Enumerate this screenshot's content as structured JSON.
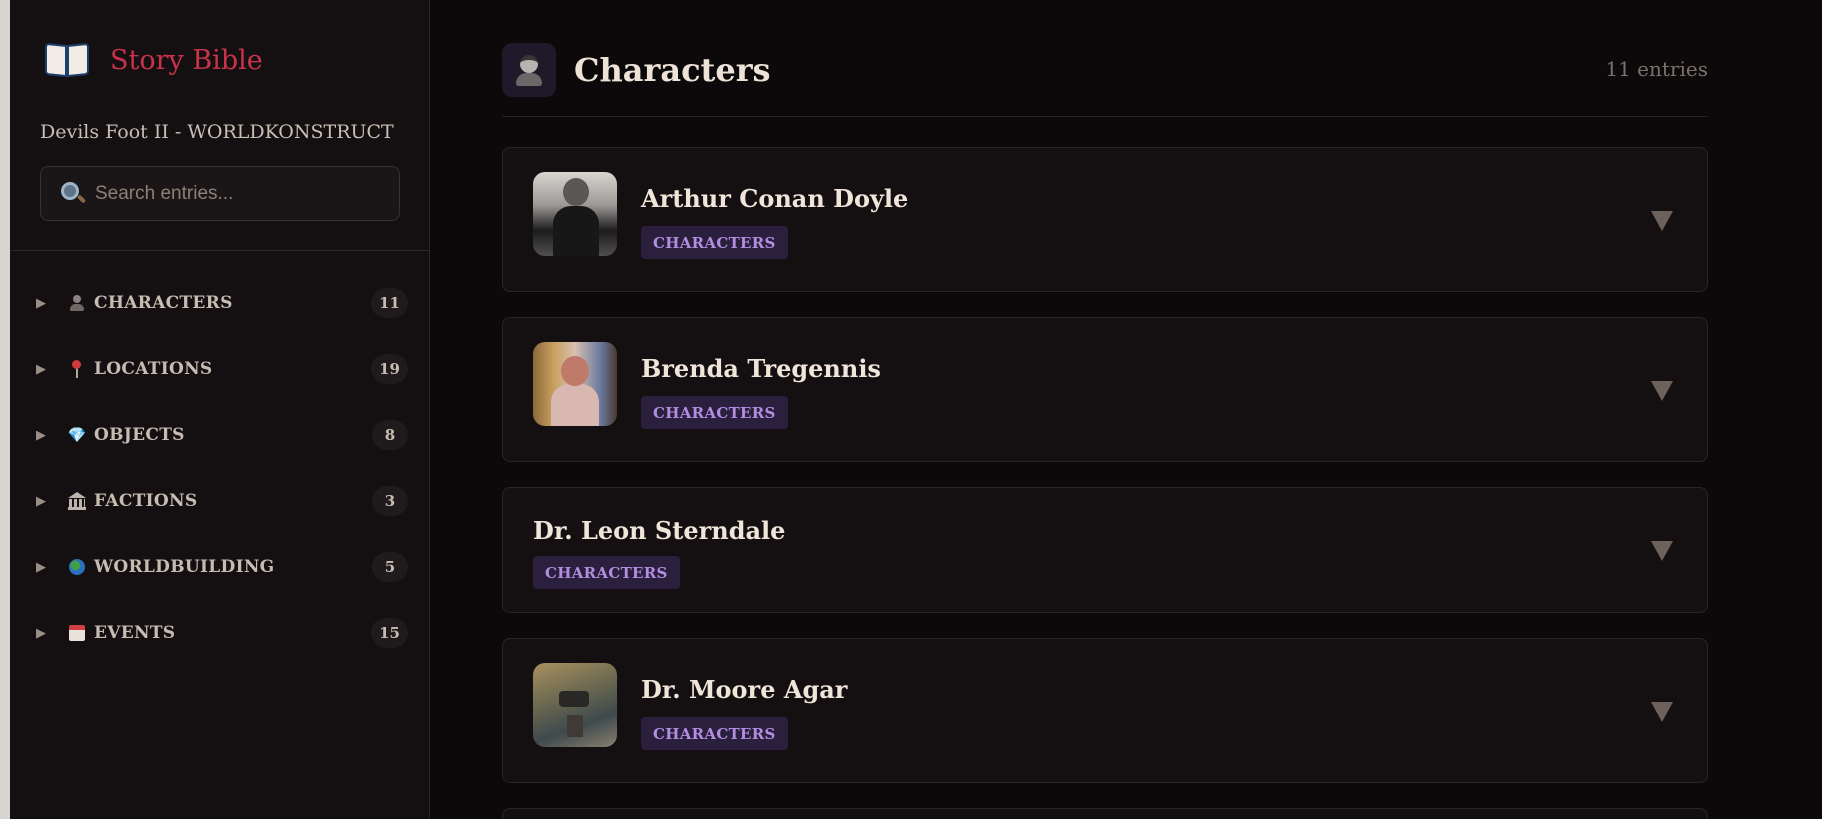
{
  "sidebar": {
    "brand_title": "Story Bible",
    "project_name": "Devils Foot II - WORLDKONSTRUCT",
    "search": {
      "placeholder": "Search entries...",
      "value": ""
    },
    "items": [
      {
        "label": "CHARACTERS",
        "count": "11",
        "icon": "person-icon"
      },
      {
        "label": "LOCATIONS",
        "count": "19",
        "icon": "pin-icon"
      },
      {
        "label": "OBJECTS",
        "count": "8",
        "icon": "gem-icon"
      },
      {
        "label": "FACTIONS",
        "count": "3",
        "icon": "bank-icon"
      },
      {
        "label": "WORLDBUILDING",
        "count": "5",
        "icon": "globe-icon"
      },
      {
        "label": "EVENTS",
        "count": "15",
        "icon": "calendar-icon"
      }
    ],
    "arrow": "▶",
    "gem_glyph": "💎"
  },
  "main": {
    "title": "Characters",
    "entry_count": "11 entries",
    "cards": [
      {
        "name": "Arthur Conan Doyle",
        "tag": "CHARACTERS",
        "has_image": true
      },
      {
        "name": "Brenda Tregennis",
        "tag": "CHARACTERS",
        "has_image": true
      },
      {
        "name": "Dr. Leon Sterndale",
        "tag": "CHARACTERS",
        "has_image": false
      },
      {
        "name": "Dr. Moore Agar",
        "tag": "CHARACTERS",
        "has_image": true
      }
    ]
  },
  "colors": {
    "accent": "#c8324a",
    "tag_bg": "#2a1f3c",
    "tag_text": "#b28ee0",
    "background": "#0c090b"
  }
}
